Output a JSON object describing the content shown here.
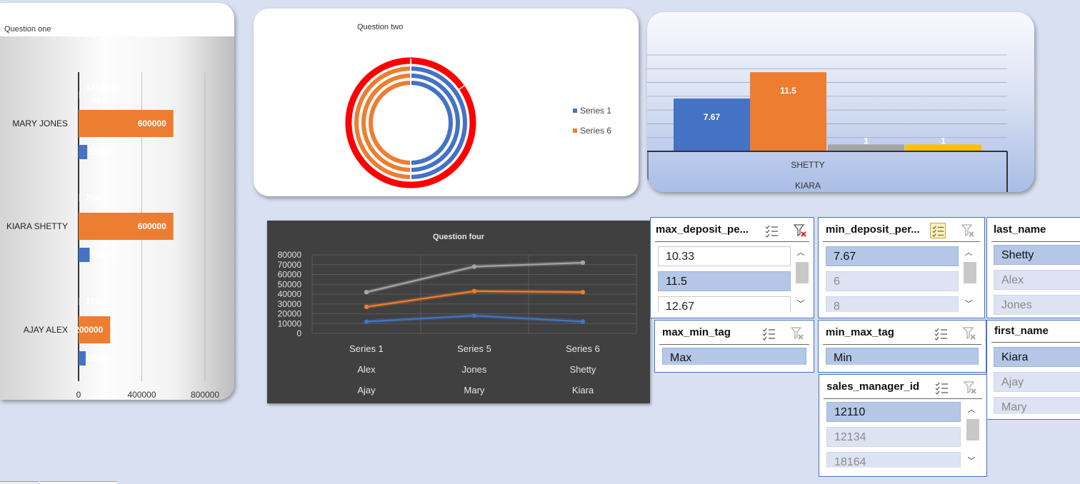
{
  "charts": {
    "q1": {
      "title": "Question  one",
      "categories": [
        "AJAY ALEX",
        "KIARA SHETTY",
        "MARY JONES"
      ],
      "series": [
        {
          "color": "#4472c4",
          "values": [
            45000,
            70000,
            55000
          ],
          "labels": [
            "45000",
            "70000",
            "55000"
          ]
        },
        {
          "color": "#ed7d31",
          "values": [
            200000,
            600000,
            600000
          ],
          "labels": [
            "200000",
            "600000",
            "600000"
          ]
        },
        {
          "color": "#a5a5a5",
          "values": [
            155,
            265,
            181.666
          ],
          "labels": [
            "155",
            "265",
            "181.666\n6667"
          ]
        }
      ],
      "xticks": [
        "0",
        "400000",
        "800000"
      ],
      "xlim": [
        0,
        900000
      ]
    },
    "q2": {
      "title": "Question  two",
      "legend": [
        {
          "name": "Series 1",
          "color": "#4472c4"
        },
        {
          "name": "Series 6",
          "color": "#ed7d31"
        }
      ]
    },
    "q3": {
      "categories_outer": "KIARA",
      "categories_inner": "SHETTY",
      "values": [
        7.67,
        11.5,
        1,
        1
      ],
      "labels": [
        "7.67",
        "11.5",
        "1",
        "1"
      ],
      "colors": [
        "#4472c4",
        "#ed7d31",
        "#a5a5a5",
        "#ffc000"
      ],
      "ylim": [
        0,
        14
      ]
    },
    "q4": {
      "title": "Question four",
      "yticks": [
        "80000",
        "70000",
        "60000",
        "50000",
        "40000",
        "30000",
        "20000",
        "10000",
        "0"
      ],
      "ylim": [
        0,
        80000
      ],
      "x_level1": [
        "Series 1",
        "Series 5",
        "Series 6"
      ],
      "x_level2": [
        "Alex",
        "Jones",
        "Shetty"
      ],
      "x_level3": [
        "Ajay",
        "Mary",
        "Kiara"
      ],
      "series": [
        {
          "color": "#a5a5a5",
          "values": [
            42000,
            68000,
            72000
          ]
        },
        {
          "color": "#ed7d31",
          "values": [
            27000,
            43000,
            42000
          ]
        },
        {
          "color": "#4472c4",
          "values": [
            12000,
            18000,
            12000
          ]
        }
      ]
    }
  },
  "chart_data": [
    {
      "type": "bar",
      "title": "Question  one",
      "categories": [
        "AJAY ALEX",
        "KIARA SHETTY",
        "MARY JONES"
      ],
      "series": [
        {
          "values": [
            45000,
            70000,
            55000
          ]
        },
        {
          "values": [
            200000,
            600000,
            600000
          ]
        },
        {
          "values": [
            155,
            265,
            181.6666667
          ]
        }
      ],
      "xlim": [
        0,
        900000
      ]
    },
    {
      "type": "pie",
      "title": "Question  two",
      "series": [
        {
          "name": "Series 1"
        },
        {
          "name": "Series 6"
        }
      ]
    },
    {
      "type": "bar",
      "categories": [
        "KIARA / SHETTY"
      ],
      "values": [
        7.67,
        11.5,
        1,
        1
      ]
    },
    {
      "type": "line",
      "title": "Question four",
      "categories": [
        "Series 1 / Alex / Ajay",
        "Series 5 / Jones / Mary",
        "Series 6 / Shetty / Kiara"
      ],
      "series": [
        {
          "values": [
            42000,
            68000,
            72000
          ]
        },
        {
          "values": [
            27000,
            43000,
            42000
          ]
        },
        {
          "values": [
            12000,
            18000,
            12000
          ]
        }
      ],
      "ylim": [
        0,
        80000
      ]
    }
  ],
  "slicers": {
    "max_deposit": {
      "title": "max_deposit_pe...",
      "items": [
        "10.33",
        "11.5",
        "12.67"
      ],
      "multiselect_icon": "multiselect-icon",
      "clear_icon": "clear-filter-icon-active"
    },
    "min_deposit": {
      "title": "min_deposit_per...",
      "items": [
        "7.67",
        "6",
        "8"
      ],
      "multiselect_icon": "multiselect-icon",
      "clear_icon": "clear-filter-icon"
    },
    "last_name": {
      "title": "last_name",
      "items": [
        "Shetty",
        "Alex",
        "Jones"
      ]
    },
    "max_min_tag": {
      "title": "max_min_tag",
      "items": [
        "Max"
      ]
    },
    "min_max_tag": {
      "title": "min_max_tag",
      "items": [
        "Min"
      ]
    },
    "first_name": {
      "title": "first_name",
      "items": [
        "Kiara",
        "Ajay",
        "Mary"
      ]
    },
    "sales_manager_id": {
      "title": "sales_manager_id",
      "items": [
        "12110",
        "12134",
        "18164"
      ]
    }
  }
}
